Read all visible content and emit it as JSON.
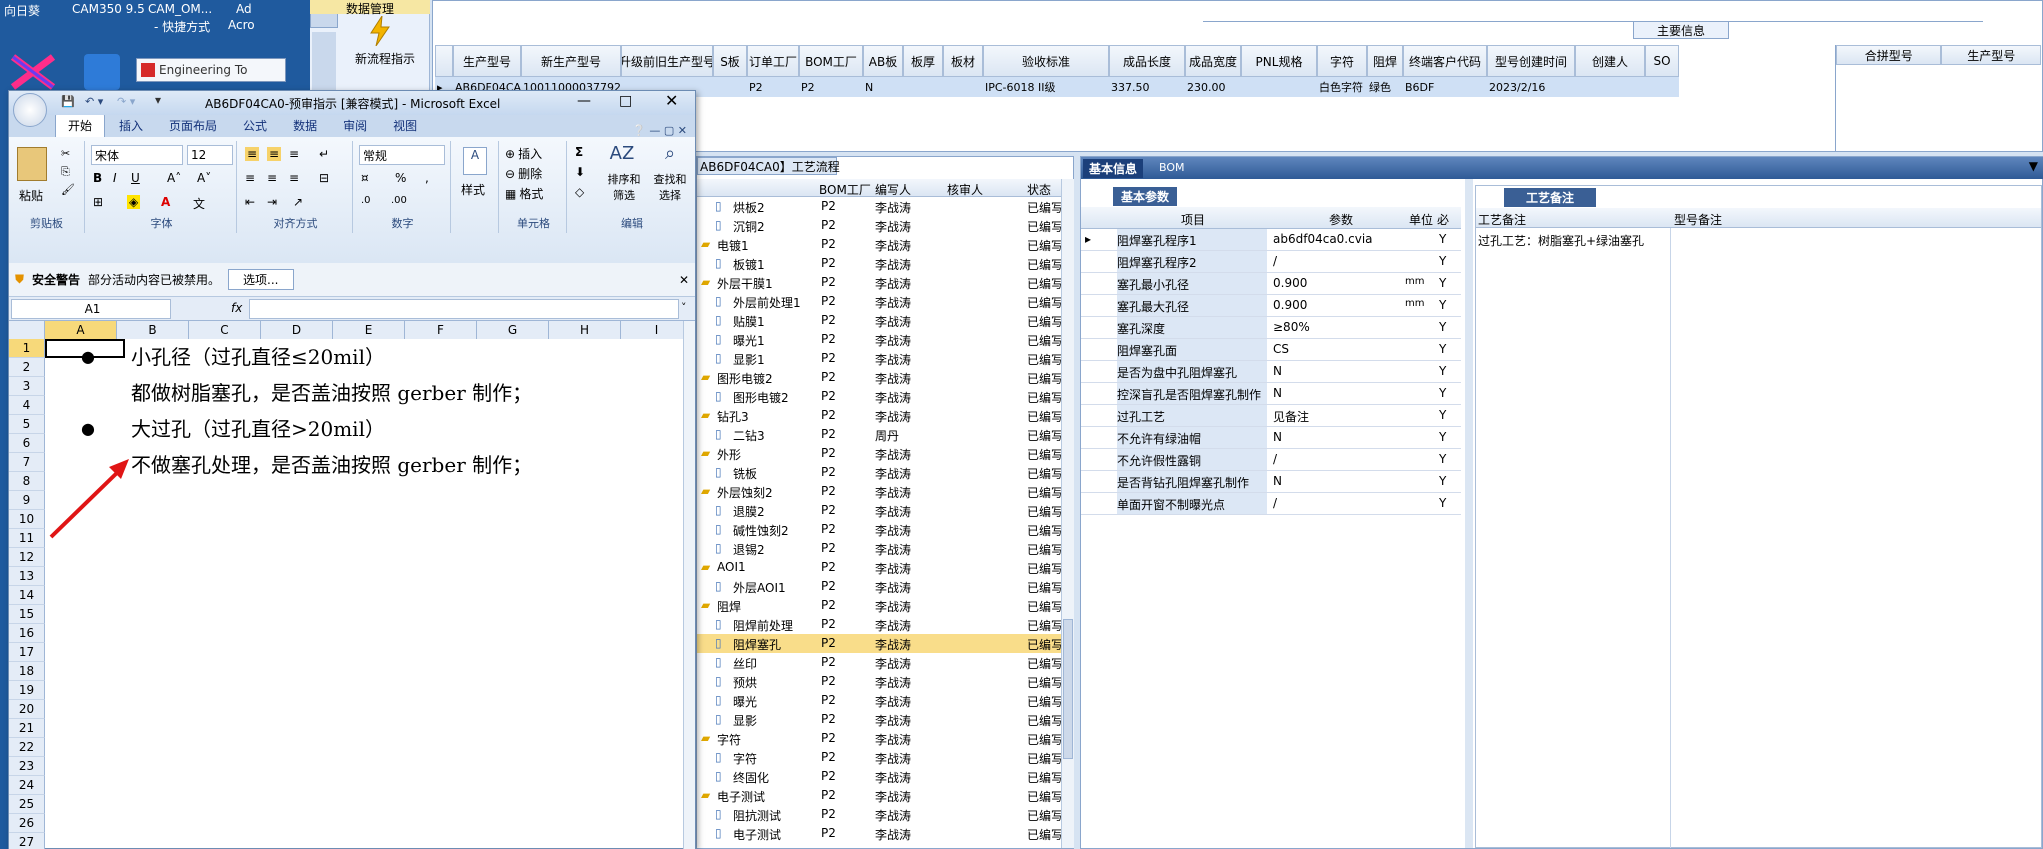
{
  "desktop": {
    "icons": [
      "向日葵",
      "CAM350 9.5",
      "CAM_OM...",
      "- 快捷方式",
      "Ad",
      "Acro"
    ],
    "taskbar_window": "Engineering To"
  },
  "mes_nav": {
    "data_mgmt": "数据管理",
    "new_flow": "新流程指示"
  },
  "top_grid": {
    "section_title": "主要信息",
    "columns": [
      "生产型号",
      "新生产型号",
      "升级前旧生产型号",
      "S板",
      "订单工厂",
      "BOM工厂",
      "AB板",
      "板厚",
      "板材",
      "验收标准",
      "成品长度",
      "成品宽度",
      "PNL规格",
      "字符",
      "阻焊",
      "终端客户代码",
      "型号创建时间",
      "创建人",
      "SO"
    ],
    "row": [
      "AB6DF04CA0",
      "10011000037792",
      "",
      "",
      "P2",
      "P2",
      "N",
      "",
      "",
      "IPC-6018 II级",
      "337.50",
      "230.00",
      "",
      "白色字符",
      "绿色",
      "B6DF",
      "2023/2/16",
      "",
      ""
    ],
    "side_columns": [
      "合拼型号",
      "生产型号"
    ]
  },
  "excel": {
    "title": "AB6DF04CA0-预审指示  [兼容模式] - Microsoft Excel",
    "tabs": [
      "开始",
      "插入",
      "页面布局",
      "公式",
      "数据",
      "审阅",
      "视图"
    ],
    "clipboard": {
      "paste": "粘贴",
      "label": "剪贴板"
    },
    "font": {
      "name": "宋体",
      "size": "12",
      "label": "字体"
    },
    "align_label": "对齐方式",
    "number": {
      "format": "常规",
      "label": "数字"
    },
    "styles": "样式",
    "cells": {
      "insert": "插入",
      "delete": "删除",
      "format": "格式",
      "label": "单元格"
    },
    "editing": {
      "sort": "排序和\n筛选",
      "find": "查找和\n选择",
      "label": "编辑"
    },
    "security": {
      "title": "安全警告",
      "msg": "部分活动内容已被禁用。",
      "btn": "选项..."
    },
    "namebox": "A1",
    "fx": "fx",
    "col_headers": [
      "A",
      "B",
      "C",
      "D",
      "E",
      "F",
      "G",
      "H",
      "I"
    ],
    "rows": [
      "1",
      "2",
      "3",
      "4",
      "5",
      "6",
      "7",
      "8",
      "9",
      "10",
      "11",
      "12",
      "13",
      "14",
      "15",
      "16",
      "17",
      "18",
      "19",
      "20",
      "21",
      "22",
      "23",
      "24",
      "25",
      "26",
      "27"
    ],
    "lines": [
      "小孔径（过孔直径≤20mil）",
      "都做树脂塞孔，是否盖油按照 gerber 制作；",
      "大过孔（过孔直径>20mil）",
      "不做塞孔处理，是否盖油按照 gerber 制作；"
    ]
  },
  "flow": {
    "title": "AB6DF04CA0】工艺流程",
    "columns": [
      "BOM工厂",
      "编写人",
      "核审人",
      "状态"
    ],
    "rows": [
      {
        "name": "烘板2",
        "f": "P2",
        "w": "李战涛",
        "s": "已编写",
        "lvl": 1,
        "folder": false
      },
      {
        "name": "沉铜2",
        "f": "P2",
        "w": "李战涛",
        "s": "已编写",
        "lvl": 1,
        "folder": false
      },
      {
        "name": "电镀1",
        "f": "P2",
        "w": "李战涛",
        "s": "已编写",
        "lvl": 0,
        "folder": true
      },
      {
        "name": "板镀1",
        "f": "P2",
        "w": "李战涛",
        "s": "已编写",
        "lvl": 1,
        "folder": false
      },
      {
        "name": "外层干膜1",
        "f": "P2",
        "w": "李战涛",
        "s": "已编写",
        "lvl": 0,
        "folder": true
      },
      {
        "name": "外层前处理1",
        "f": "P2",
        "w": "李战涛",
        "s": "已编写",
        "lvl": 1,
        "folder": false
      },
      {
        "name": "贴膜1",
        "f": "P2",
        "w": "李战涛",
        "s": "已编写",
        "lvl": 1,
        "folder": false
      },
      {
        "name": "曝光1",
        "f": "P2",
        "w": "李战涛",
        "s": "已编写",
        "lvl": 1,
        "folder": false
      },
      {
        "name": "显影1",
        "f": "P2",
        "w": "李战涛",
        "s": "已编写",
        "lvl": 1,
        "folder": false
      },
      {
        "name": "图形电镀2",
        "f": "P2",
        "w": "李战涛",
        "s": "已编写",
        "lvl": 0,
        "folder": true
      },
      {
        "name": "图形电镀2",
        "f": "P2",
        "w": "李战涛",
        "s": "已编写",
        "lvl": 1,
        "folder": false
      },
      {
        "name": "钻孔3",
        "f": "P2",
        "w": "李战涛",
        "s": "已编写",
        "lvl": 0,
        "folder": true
      },
      {
        "name": "二钻3",
        "f": "P2",
        "w": "周丹",
        "s": "已编写",
        "lvl": 1,
        "folder": false
      },
      {
        "name": "外形",
        "f": "P2",
        "w": "李战涛",
        "s": "已编写",
        "lvl": 0,
        "folder": true
      },
      {
        "name": "铣板",
        "f": "P2",
        "w": "李战涛",
        "s": "已编写",
        "lvl": 1,
        "folder": false
      },
      {
        "name": "外层蚀刻2",
        "f": "P2",
        "w": "李战涛",
        "s": "已编写",
        "lvl": 0,
        "folder": true
      },
      {
        "name": "退膜2",
        "f": "P2",
        "w": "李战涛",
        "s": "已编写",
        "lvl": 1,
        "folder": false
      },
      {
        "name": "碱性蚀刻2",
        "f": "P2",
        "w": "李战涛",
        "s": "已编写",
        "lvl": 1,
        "folder": false
      },
      {
        "name": "退锡2",
        "f": "P2",
        "w": "李战涛",
        "s": "已编写",
        "lvl": 1,
        "folder": false
      },
      {
        "name": "AOI1",
        "f": "P2",
        "w": "李战涛",
        "s": "已编写",
        "lvl": 0,
        "folder": true
      },
      {
        "name": "外层AOI1",
        "f": "P2",
        "w": "李战涛",
        "s": "已编写",
        "lvl": 1,
        "folder": false
      },
      {
        "name": "阻焊",
        "f": "P2",
        "w": "李战涛",
        "s": "已编写",
        "lvl": 0,
        "folder": true
      },
      {
        "name": "阻焊前处理",
        "f": "P2",
        "w": "李战涛",
        "s": "已编写",
        "lvl": 1,
        "folder": false
      },
      {
        "name": "阻焊塞孔",
        "f": "P2",
        "w": "李战涛",
        "s": "已编写",
        "lvl": 1,
        "folder": false,
        "sel": true
      },
      {
        "name": "丝印",
        "f": "P2",
        "w": "李战涛",
        "s": "已编写",
        "lvl": 1,
        "folder": false
      },
      {
        "name": "预烘",
        "f": "P2",
        "w": "李战涛",
        "s": "已编写",
        "lvl": 1,
        "folder": false
      },
      {
        "name": "曝光",
        "f": "P2",
        "w": "李战涛",
        "s": "已编写",
        "lvl": 1,
        "folder": false
      },
      {
        "name": "显影",
        "f": "P2",
        "w": "李战涛",
        "s": "已编写",
        "lvl": 1,
        "folder": false
      },
      {
        "name": "字符",
        "f": "P2",
        "w": "李战涛",
        "s": "已编写",
        "lvl": 0,
        "folder": true
      },
      {
        "name": "字符",
        "f": "P2",
        "w": "李战涛",
        "s": "已编写",
        "lvl": 1,
        "folder": false
      },
      {
        "name": "终固化",
        "f": "P2",
        "w": "李战涛",
        "s": "已编写",
        "lvl": 1,
        "folder": false
      },
      {
        "name": "电子测试",
        "f": "P2",
        "w": "李战涛",
        "s": "已编写",
        "lvl": 0,
        "folder": true
      },
      {
        "name": "阻抗测试",
        "f": "P2",
        "w": "李战涛",
        "s": "已编写",
        "lvl": 1,
        "folder": false
      },
      {
        "name": "电子测试",
        "f": "P2",
        "w": "李战涛",
        "s": "已编写",
        "lvl": 1,
        "folder": false
      }
    ]
  },
  "basic": {
    "tab_basic": "基本信息",
    "tab_bom": "BOM",
    "subtab": "基本参数",
    "columns": [
      "项目",
      "参数",
      "单位",
      "必"
    ],
    "rows": [
      {
        "item": "阻焊塞孔程序1",
        "val": "ab6df04ca0.cvia",
        "unit": "",
        "y": "Y"
      },
      {
        "item": "阻焊塞孔程序2",
        "val": "/",
        "unit": "",
        "y": "Y"
      },
      {
        "item": "塞孔最小孔径",
        "val": "0.900",
        "unit": "mm",
        "y": "Y"
      },
      {
        "item": "塞孔最大孔径",
        "val": "0.900",
        "unit": "mm",
        "y": "Y"
      },
      {
        "item": "塞孔深度",
        "val": "≥80%",
        "unit": "",
        "y": "Y"
      },
      {
        "item": "阻焊塞孔面",
        "val": "CS",
        "unit": "",
        "y": "Y"
      },
      {
        "item": "是否为盘中孔阻焊塞孔",
        "val": "N",
        "unit": "",
        "y": "Y"
      },
      {
        "item": "控深盲孔是否阻焊塞孔制作",
        "val": "N",
        "unit": "",
        "y": "Y"
      },
      {
        "item": "过孔工艺",
        "val": "见备注",
        "unit": "",
        "y": "Y"
      },
      {
        "item": "不允许有绿油帽",
        "val": "N",
        "unit": "",
        "y": "Y"
      },
      {
        "item": "不允许假性露铜",
        "val": "/",
        "unit": "",
        "y": "Y"
      },
      {
        "item": "是否背钻孔阻焊塞孔制作",
        "val": "N",
        "unit": "",
        "y": "Y"
      },
      {
        "item": "单面开窗不制曝光点",
        "val": "/",
        "unit": "",
        "y": "Y"
      }
    ],
    "notes_tab": "工艺备注",
    "notes_cols": [
      "工艺备注",
      "型号备注"
    ],
    "note_text": "过孔工艺：树脂塞孔+绿油塞孔"
  }
}
